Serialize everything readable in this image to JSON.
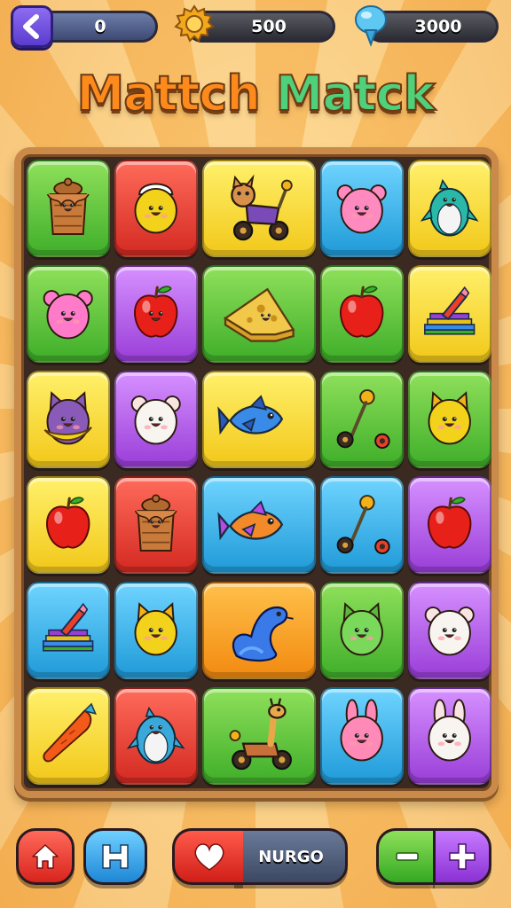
{
  "hud": {
    "moves": "0",
    "coins": "500",
    "gems": "3000"
  },
  "title": {
    "part1": "Mattch",
    "part2": "Matck"
  },
  "board": {
    "rows": [
      [
        {
          "icon": "basket-creature-icon",
          "color": "green"
        },
        {
          "icon": "yellow-chick-icon",
          "color": "red"
        },
        {
          "icon": "horse-cart-icon",
          "color": "yellow"
        },
        {
          "icon": "pink-mouse-icon",
          "color": "blue"
        },
        {
          "icon": "teal-penguin-icon",
          "color": "yellow"
        }
      ],
      [
        {
          "icon": "pink-bear-icon",
          "color": "green"
        },
        {
          "icon": "smiling-apple-icon",
          "color": "purple"
        },
        {
          "icon": "cheese-wedge-icon",
          "color": "green"
        },
        {
          "icon": "red-apple-icon",
          "color": "green"
        },
        {
          "icon": "book-stack-pencil-icon",
          "color": "yellow"
        }
      ],
      [
        {
          "icon": "purple-cat-banana-icon",
          "color": "yellow"
        },
        {
          "icon": "white-hamster-icon",
          "color": "purple"
        },
        {
          "icon": "blue-fish-icon",
          "color": "yellow"
        },
        {
          "icon": "scooter-icon",
          "color": "green"
        },
        {
          "icon": "yellow-fox-icon",
          "color": "green"
        }
      ],
      [
        {
          "icon": "red-apple-icon",
          "color": "yellow"
        },
        {
          "icon": "basket-creature-icon",
          "color": "red"
        },
        {
          "icon": "orange-fish-icon",
          "color": "blue"
        },
        {
          "icon": "scooter-icon",
          "color": "blue"
        },
        {
          "icon": "red-apple-icon",
          "color": "purple"
        }
      ],
      [
        {
          "icon": "book-stack-pencil-icon",
          "color": "blue"
        },
        {
          "icon": "yellow-fox-icon",
          "color": "blue"
        },
        {
          "icon": "blue-seal-icon",
          "color": "orange"
        },
        {
          "icon": "green-cat-icon",
          "color": "green"
        },
        {
          "icon": "white-hamster-icon",
          "color": "purple"
        }
      ],
      [
        {
          "icon": "orange-carrot-icon",
          "color": "yellow"
        },
        {
          "icon": "blue-penguin-icon",
          "color": "red"
        },
        {
          "icon": "giraffe-bike-icon",
          "color": "green"
        },
        {
          "icon": "pink-bunny-icon",
          "color": "blue"
        },
        {
          "icon": "white-bunny-icon",
          "color": "purple"
        }
      ]
    ]
  },
  "bottom": {
    "nurgo_label": "NURGO"
  }
}
